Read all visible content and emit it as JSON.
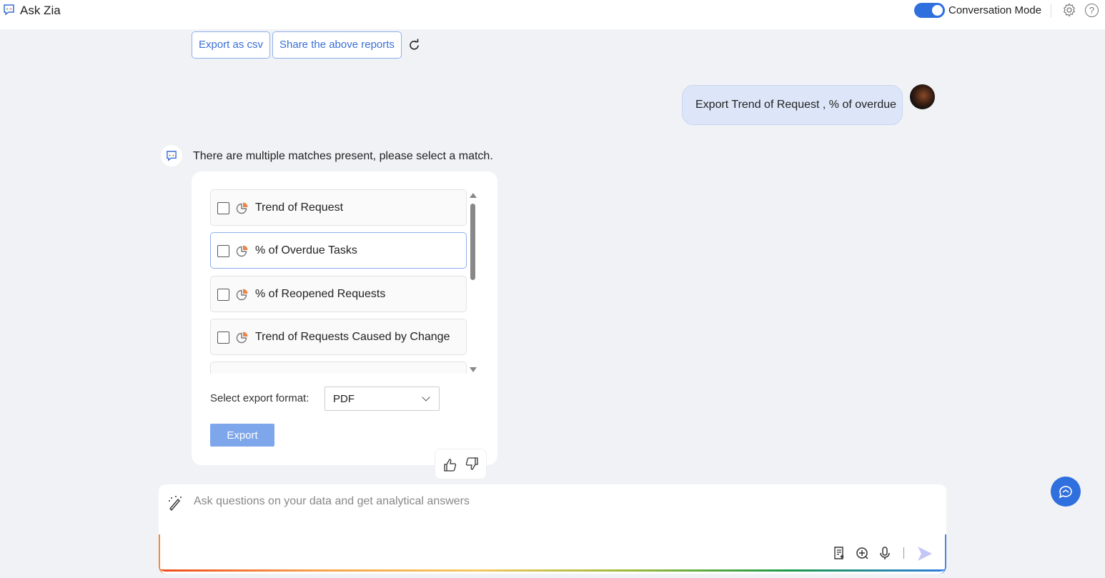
{
  "header": {
    "title": "Ask Zia",
    "conversation_mode_label": "Conversation Mode",
    "conversation_mode_on": true,
    "help_label": "?"
  },
  "actions": {
    "export_csv": "Export as csv",
    "share_reports": "Share the above reports"
  },
  "user_message": "Export Trend of Request , % of overdue",
  "bot": {
    "message": "There are multiple matches present, please select a match.",
    "matches": [
      {
        "label": "Trend of Request",
        "checked": false
      },
      {
        "label": "% of Overdue Tasks",
        "checked": false
      },
      {
        "label": "% of Reopened Requests",
        "checked": false
      },
      {
        "label": "Trend of Requests Caused by Change",
        "checked": false
      }
    ],
    "format_label": "Select export format:",
    "format_value": "PDF",
    "export_label": "Export"
  },
  "input": {
    "placeholder": "Ask questions on your data and get analytical answers"
  },
  "colors": {
    "accent": "#2f6fde",
    "export_disabled": "#7ea6ea",
    "user_bubble": "#dde6f8"
  }
}
